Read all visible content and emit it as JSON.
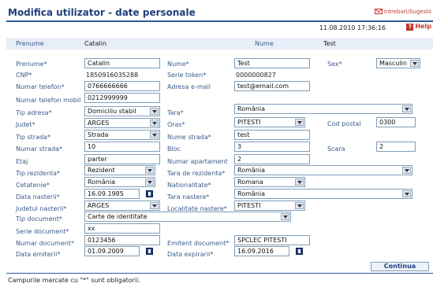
{
  "header": {
    "title": "Modifica utilizator - date personale",
    "feedback_link": "Intrebari/Sugestii",
    "datetime": "11.08.2010 17:36:16",
    "help_label": "Help"
  },
  "summary": {
    "first_name_label": "Prenume",
    "first_name_value": "Catalin",
    "last_name_label": "Nume",
    "last_name_value": "Test"
  },
  "form": {
    "prenume": {
      "label": "Prenume*",
      "value": "Catalin"
    },
    "nume": {
      "label": "Nume*",
      "value": "Test"
    },
    "sex": {
      "label": "Sex*",
      "value": "Masculin"
    },
    "cnp": {
      "label": "CNP*",
      "value": "1850916035288"
    },
    "serie_token": {
      "label": "Serie token*",
      "value": "0000000827"
    },
    "telefon": {
      "label": "Numar telefon*",
      "value": "0766666666"
    },
    "email": {
      "label": "Adresa e-mail",
      "value": "test@email.com"
    },
    "mobil": {
      "label": "Numar telefon mobil",
      "value": "0212999999"
    },
    "tip_adresa": {
      "label": "Tip adresa*",
      "value": "Domiciliu stabil"
    },
    "tara": {
      "label": "Tara*",
      "value": "România"
    },
    "judet": {
      "label": "Judet*",
      "value": "ARGES"
    },
    "oras": {
      "label": "Oras*",
      "value": "PITESTI"
    },
    "cod_postal": {
      "label": "Cod postal",
      "value": "0300"
    },
    "tip_strada": {
      "label": "Tip strada*",
      "value": "Strada"
    },
    "nume_strada": {
      "label": "Nume strada*",
      "value": "test"
    },
    "numar_strada": {
      "label": "Numar strada*",
      "value": "10"
    },
    "bloc": {
      "label": "Bloc",
      "value": "3"
    },
    "scara": {
      "label": "Scara",
      "value": "2"
    },
    "etaj": {
      "label": "Etaj",
      "value": "parter"
    },
    "apartament": {
      "label": "Numar apartament",
      "value": "2"
    },
    "tip_rezidenta": {
      "label": "Tip rezidenta*",
      "value": "Rezident"
    },
    "tara_rezidenta": {
      "label": "Tara de rezidenta*",
      "value": "România"
    },
    "cetatenie": {
      "label": "Cetatenie*",
      "value": "România"
    },
    "nationalitate": {
      "label": "Nationalitate*",
      "value": "Romana"
    },
    "data_nasterii": {
      "label": "Data nasterii*",
      "value": "16.09.1985"
    },
    "tara_nastere": {
      "label": "Tara nastere*",
      "value": "România"
    },
    "judet_nasterii": {
      "label": "Judetul nasterii*",
      "value": "ARGES"
    },
    "localitate_nastere": {
      "label": "Localitate nastere*",
      "value": "PITESTI"
    },
    "tip_document": {
      "label": "Tip document*",
      "value": "Carte de identitate"
    },
    "serie_document": {
      "label": "Serie document*",
      "value": "xx"
    },
    "numar_document": {
      "label": "Numar document*",
      "value": "0123456"
    },
    "emitent_document": {
      "label": "Emitent document*",
      "value": "SPCLEC PITESTI"
    },
    "data_emiterii": {
      "label": "Data emiterii*",
      "value": "01.09.2009"
    },
    "data_expirarii": {
      "label": "Data expirarii*",
      "value": "16.09.2016"
    }
  },
  "actions": {
    "continue_label": "Continua"
  },
  "footer": {
    "note": "Campurile marcate cu \"*\" sunt obligatorii."
  },
  "colors": {
    "title": "#1f3f7a",
    "label": "#3a5b8c",
    "accent_red": "#c0392b",
    "summary_bg": "#e8eef7"
  },
  "icons": {
    "feedback": "envelope-icon",
    "help": "help-icon",
    "calendar": "calendar-icon"
  }
}
